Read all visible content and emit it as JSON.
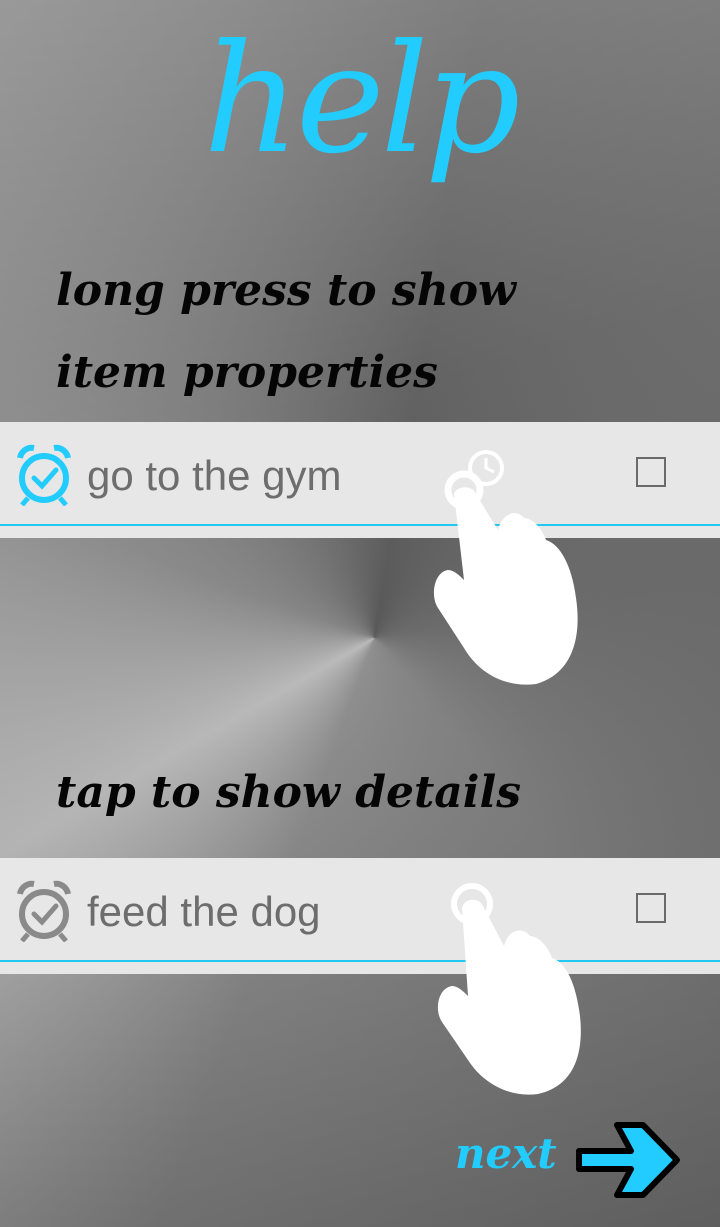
{
  "page": {
    "title": "help",
    "accent_color": "#22ccff"
  },
  "hints": {
    "long_press": "long press to show item properties",
    "tap": "tap to show details"
  },
  "items": [
    {
      "label": "go to the gym",
      "icon": "alarm-clock-icon",
      "icon_color": "#22ccff",
      "checked": false
    },
    {
      "label": "feed the dog",
      "icon": "alarm-clock-icon",
      "icon_color": "#8a8a8a",
      "checked": false
    }
  ],
  "gestures": {
    "first": "long-press-hand-icon",
    "second": "tap-hand-icon"
  },
  "footer": {
    "next_label": "next",
    "next_icon": "arrow-right-icon"
  }
}
